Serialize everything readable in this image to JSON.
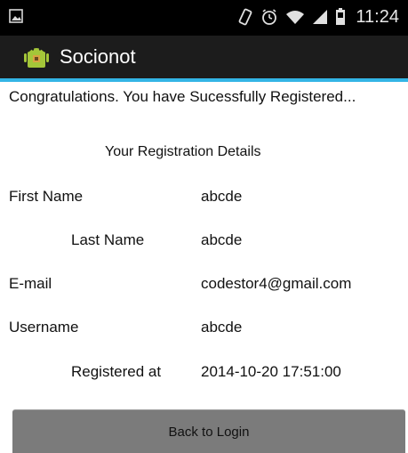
{
  "status_bar": {
    "time": "11:24",
    "icons": [
      "image-notification-icon",
      "vibrate-icon",
      "alarm-icon",
      "wifi-icon",
      "signal-icon",
      "battery-icon"
    ]
  },
  "action_bar": {
    "app_icon": "android-icon",
    "title": "Socionot"
  },
  "content": {
    "message": "Congratulations. You have Sucessfully Registered...",
    "section_title": "Your Registration Details",
    "rows": [
      {
        "label": "First Name",
        "value": "abcde"
      },
      {
        "label": "Last Name",
        "value": "abcde"
      },
      {
        "label": "E-mail",
        "value": "codestor4@gmail.com"
      },
      {
        "label": "Username",
        "value": "abcde"
      },
      {
        "label": "Registered at",
        "value": "2014-10-20 17:51:00"
      }
    ]
  },
  "buttons": {
    "back_to_login": "Back to Login"
  },
  "colors": {
    "accent": "#33b5e5",
    "status_bar": "#000000",
    "action_bar": "#1c1c1c",
    "button": "#7b7b7b"
  }
}
